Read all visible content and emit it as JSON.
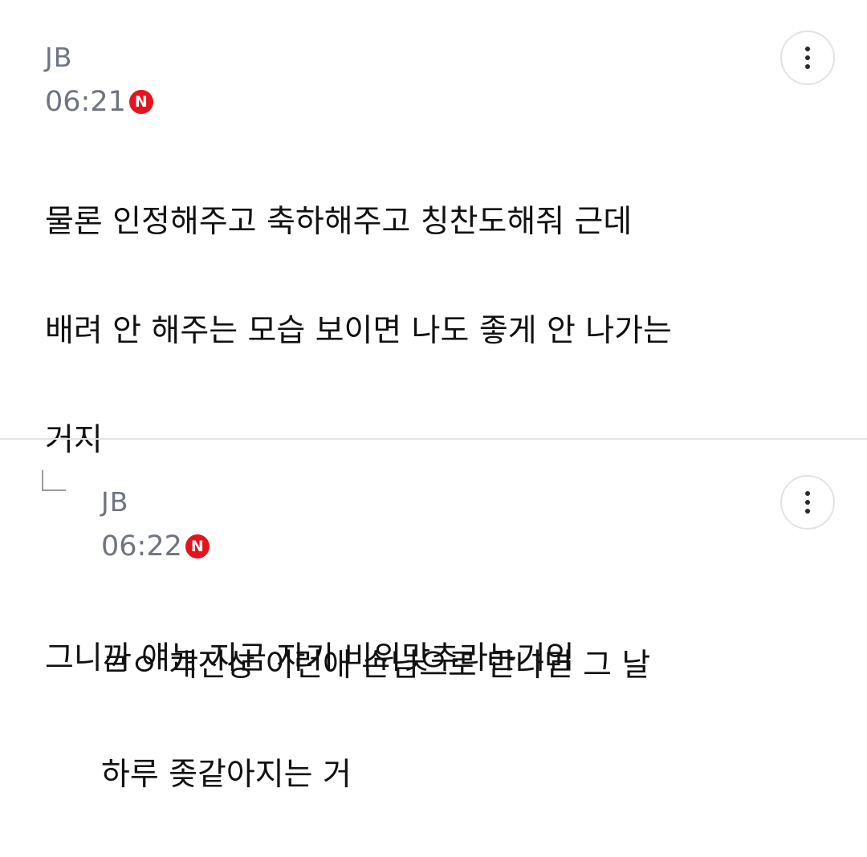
{
  "comments": [
    {
      "author": "JB",
      "time": "06:21",
      "badge": "N",
      "lines": [
        "물론 인정해주고 축하해주고 칭찬도해줘 근데",
        "배려 안 해주는 모습 보이면 나도 좋게 안 나가는",
        "거지",
        "",
        "그니까 얘는 지금 자기 비위맞추라는거임"
      ]
    },
    {
      "author": "JB",
      "time": "06:22",
      "badge": "N",
      "lines": [
        "ㄹㅇ 개진상 이런애 손님으로 만나면 그 날",
        "하루 좆같아지는 거"
      ]
    }
  ],
  "colors": {
    "meta": "#6f7480",
    "badge": "#e4141e",
    "divider": "#e4e4e4"
  },
  "icons": {
    "more": "more-vertical-icon",
    "reply": "reply-arrow-icon"
  }
}
